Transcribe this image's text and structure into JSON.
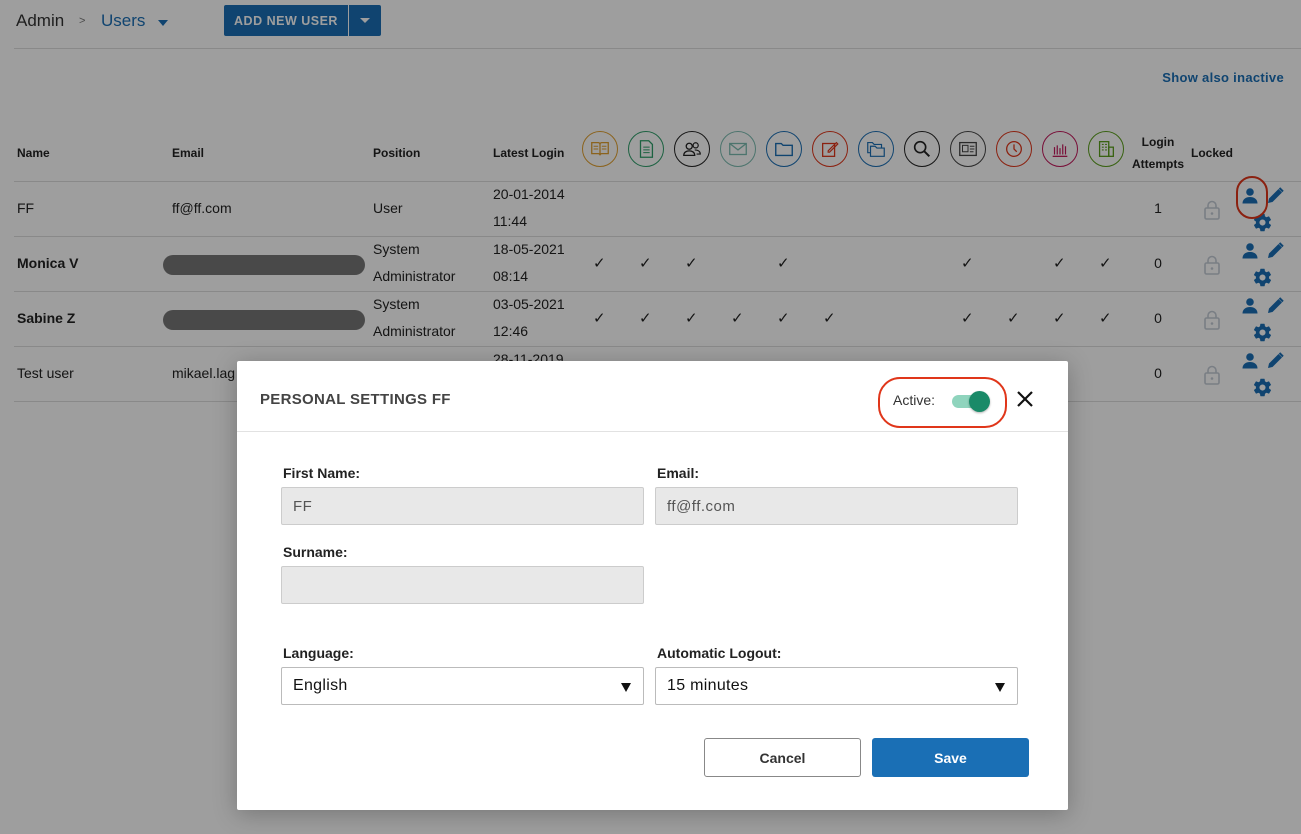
{
  "breadcrumb": {
    "root": "Admin",
    "separator": ">",
    "current": "Users"
  },
  "toolbar": {
    "add_new_user_label": "ADD NEW USER"
  },
  "show_inactive_label": "Show also inactive",
  "table": {
    "headers": {
      "name": "Name",
      "email": "Email",
      "position": "Position",
      "latest_login": "Latest Login",
      "login_attempts_line1": "Login",
      "login_attempts_line2": "Attempts",
      "locked": "Locked"
    },
    "permission_icons": [
      {
        "icon": "book-icon",
        "color": "#e0a030"
      },
      {
        "icon": "document-icon",
        "color": "#2e9e6a"
      },
      {
        "icon": "users-group-icon",
        "color": "#222222"
      },
      {
        "icon": "mail-icon",
        "color": "#7bbcb0"
      },
      {
        "icon": "folder-icon",
        "color": "#1a6fb5"
      },
      {
        "icon": "edit-note-icon",
        "color": "#e0361a"
      },
      {
        "icon": "folders-icon",
        "color": "#1a6fb5"
      },
      {
        "icon": "search-icon",
        "color": "#222222"
      },
      {
        "icon": "id-card-icon",
        "color": "#444444"
      },
      {
        "icon": "clock-icon",
        "color": "#e0361a"
      },
      {
        "icon": "bar-chart-icon",
        "color": "#c2185b"
      },
      {
        "icon": "building-icon",
        "color": "#5a9e1a"
      }
    ],
    "rows": [
      {
        "name": "FF",
        "name_bold": false,
        "email": "ff@ff.com",
        "email_redacted": false,
        "position_line1": "User",
        "position_line2": "",
        "login_date": "20-01-2014",
        "login_time": "11:44",
        "permissions": [
          false,
          false,
          false,
          false,
          false,
          false,
          false,
          false,
          false,
          false,
          false,
          false
        ],
        "attempts": "1"
      },
      {
        "name": "Monica V",
        "name_bold": true,
        "email": "",
        "email_redacted": true,
        "position_line1": "System",
        "position_line2": "Administrator",
        "login_date": "18-05-2021",
        "login_time": "08:14",
        "permissions": [
          true,
          true,
          true,
          false,
          true,
          false,
          false,
          false,
          true,
          false,
          true,
          true
        ],
        "attempts": "0"
      },
      {
        "name": "Sabine Z",
        "name_bold": true,
        "email": "",
        "email_redacted": true,
        "position_line1": "System",
        "position_line2": "Administrator",
        "login_date": "03-05-2021",
        "login_time": "12:46",
        "permissions": [
          true,
          true,
          true,
          true,
          true,
          true,
          false,
          false,
          true,
          true,
          true,
          true
        ],
        "attempts": "0"
      },
      {
        "name": "Test user",
        "name_bold": false,
        "email": "mikael.lag",
        "email_redacted": false,
        "position_line1": "",
        "position_line2": "",
        "login_date": "28-11-2019",
        "login_time": "",
        "permissions": [
          false,
          false,
          false,
          false,
          false,
          false,
          false,
          false,
          false,
          false,
          false,
          false
        ],
        "attempts": "0"
      }
    ],
    "check_glyph": "✓"
  },
  "modal": {
    "title": "PERSONAL SETTINGS FF",
    "active_label": "Active:",
    "active_on": true,
    "first_name_label": "First Name:",
    "first_name_value": "FF",
    "email_label": "Email:",
    "email_value": "ff@ff.com",
    "surname_label": "Surname:",
    "surname_value": "",
    "language_label": "Language:",
    "language_value": "English",
    "logout_label": "Automatic Logout:",
    "logout_value": "15 minutes",
    "cancel_label": "Cancel",
    "save_label": "Save"
  },
  "colors": {
    "accent": "#1a6fb5",
    "toggle_on": "#1a8a68",
    "highlight": "#e0361a"
  }
}
